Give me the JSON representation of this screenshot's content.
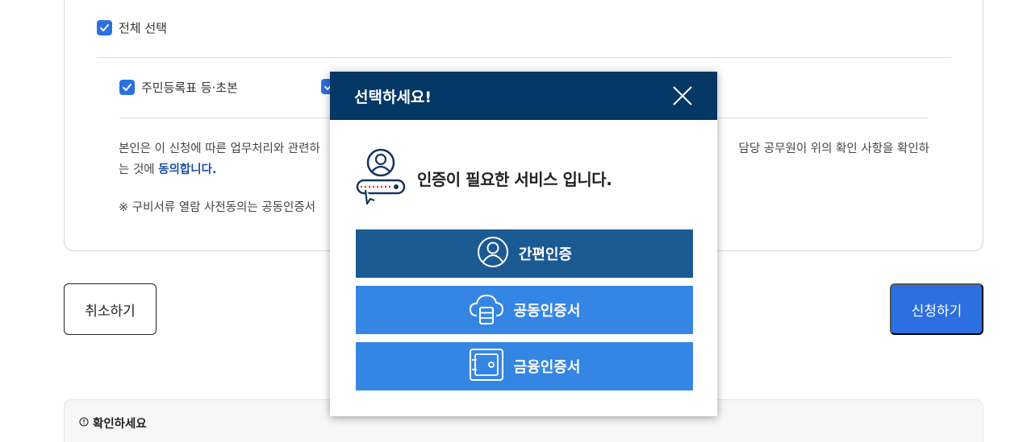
{
  "form": {
    "select_all_label": "전체 선택",
    "items": [
      {
        "label": "주민등록표 등·초본"
      }
    ],
    "consent_text_left": "본인은 이 신청에 따른 업무처리와 관련하",
    "consent_text_right": "담당 공무원이 위의 확인 사항을 확인하",
    "consent_line2_prefix": "는 것에 ",
    "consent_agree": "동의합니다.",
    "note_text": "※ 구비서류 열람 사전동의는 공동인증서"
  },
  "actions": {
    "cancel_label": "취소하기",
    "apply_label": "신청하기"
  },
  "confirm": {
    "title": "확인하세요",
    "icon": "info-icon"
  },
  "modal": {
    "title": "선택하세요!",
    "message": "인증이 필요한 서비스 입니다.",
    "options": [
      {
        "label": "간편인증",
        "icon": "person-icon"
      },
      {
        "label": "공동인증서",
        "icon": "cloud-database-icon"
      },
      {
        "label": "금융인증서",
        "icon": "safe-icon"
      }
    ]
  },
  "colors": {
    "primary": "#2b6fe0",
    "modal_header": "#043765",
    "auth_dark": "#1c5a93",
    "auth_light": "#3586e4"
  }
}
